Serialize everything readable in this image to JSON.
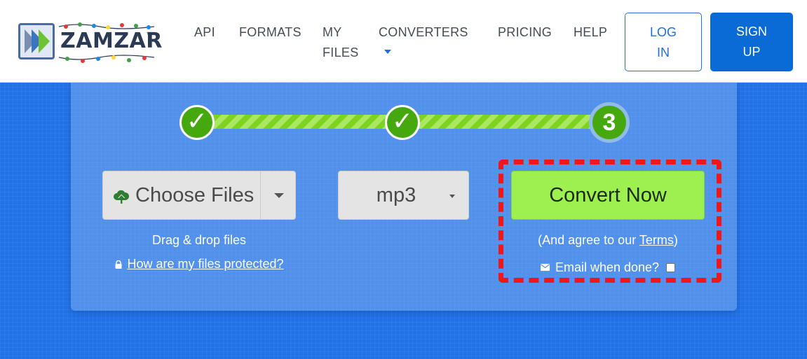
{
  "brand": {
    "name": "ZAMZAR",
    "tm": "™"
  },
  "nav": {
    "api": "API",
    "formats": "FORMATS",
    "my_files_line1": "MY",
    "my_files_line2": "FILES",
    "converters": "CONVERTERS",
    "pricing": "PRICING",
    "help": "HELP"
  },
  "auth": {
    "login_line1": "LOG",
    "login_line2": "IN",
    "signup_line1": "SIGN",
    "signup_line2": "UP"
  },
  "steps": {
    "step1_mark": "✓",
    "step2_mark": "✓",
    "step3_number": "3"
  },
  "upload": {
    "choose_label": "Choose Files",
    "drag_text": "Drag & drop files",
    "protected_link": "How are my files protected?"
  },
  "format": {
    "selected": "mp3"
  },
  "convert": {
    "button_label": "Convert Now",
    "agree_prefix": "(And agree to our ",
    "terms_link": "Terms",
    "agree_suffix": ")",
    "email_label": "Email when done?"
  },
  "colors": {
    "brand_blue": "#1f6fe0",
    "convert_green": "#9ef050",
    "step_green": "#45a80f",
    "highlight_red": "#f0171b"
  }
}
